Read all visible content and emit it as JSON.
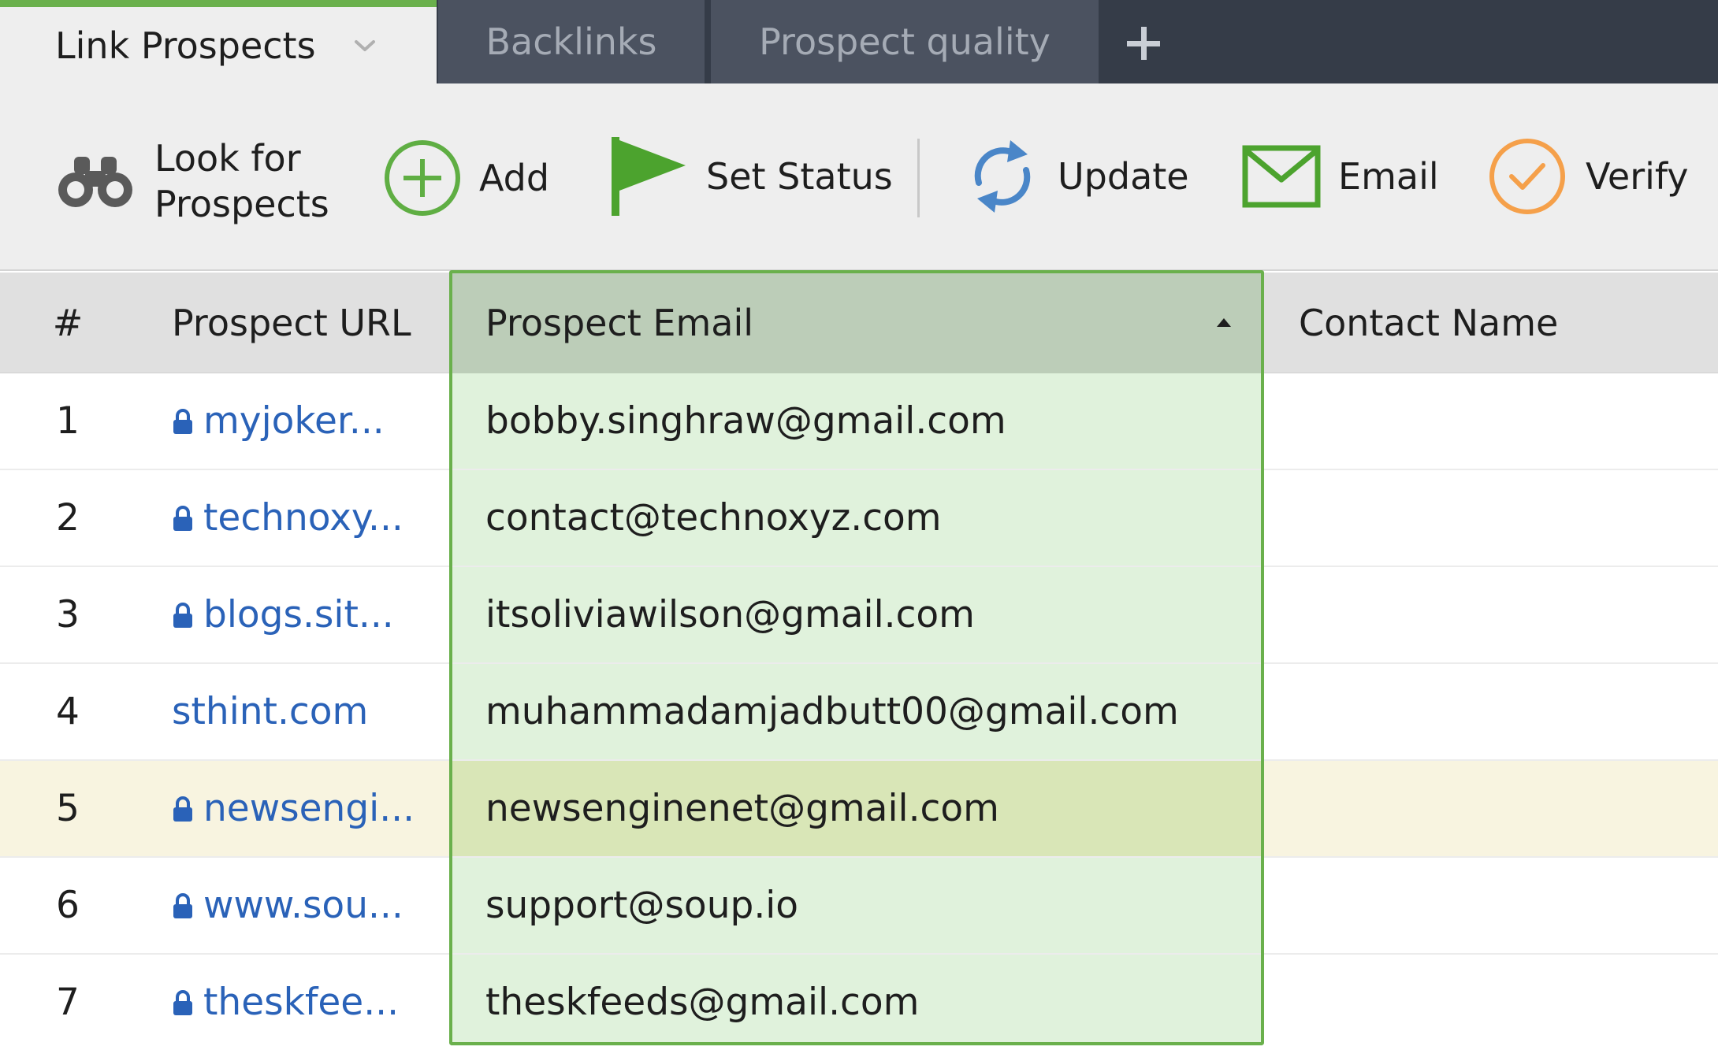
{
  "tabs": {
    "active": {
      "label": "Link Prospects"
    },
    "backlinks": {
      "label": "Backlinks"
    },
    "quality": {
      "label": "Prospect quality"
    },
    "add_icon": "plus-icon"
  },
  "toolbar": {
    "look_label_line1": "Look for",
    "look_label_line2": "Prospects",
    "add_label": "Add",
    "set_status_label": "Set Status",
    "update_label": "Update",
    "email_label": "Email",
    "verify_label": "Verify"
  },
  "colors": {
    "accent_green": "#6ab04c",
    "link_blue": "#2a62b8",
    "verify_orange": "#f5a04a",
    "update_blue": "#4a86c8",
    "selected_column": "#e0f2dc",
    "selected_row": "#f8f4e0"
  },
  "table": {
    "headers": {
      "num": "#",
      "url": "Prospect URL",
      "email": "Prospect Email",
      "contact": "Contact Name"
    },
    "sort": {
      "column": "email",
      "direction": "ascending"
    },
    "rows": [
      {
        "num": "1",
        "url": "myjoker...",
        "secure": true,
        "email": "bobby.singhraw@gmail.com",
        "contact": ""
      },
      {
        "num": "2",
        "url": "technoxy...",
        "secure": true,
        "email": "contact@technoxyz.com",
        "contact": ""
      },
      {
        "num": "3",
        "url": "blogs.sit...",
        "secure": true,
        "email": "itsoliviawilson@gmail.com",
        "contact": ""
      },
      {
        "num": "4",
        "url": "sthint.com",
        "secure": false,
        "email": "muhammadamjadbutt00@gmail.com",
        "contact": ""
      },
      {
        "num": "5",
        "url": "newsengi...",
        "secure": true,
        "email": "newsenginenet@gmail.com",
        "contact": "",
        "selected": true
      },
      {
        "num": "6",
        "url": "www.sou...",
        "secure": true,
        "email": "support@soup.io",
        "contact": ""
      },
      {
        "num": "7",
        "url": "theskfee...",
        "secure": true,
        "email": "theskfeeds@gmail.com",
        "contact": ""
      }
    ]
  }
}
